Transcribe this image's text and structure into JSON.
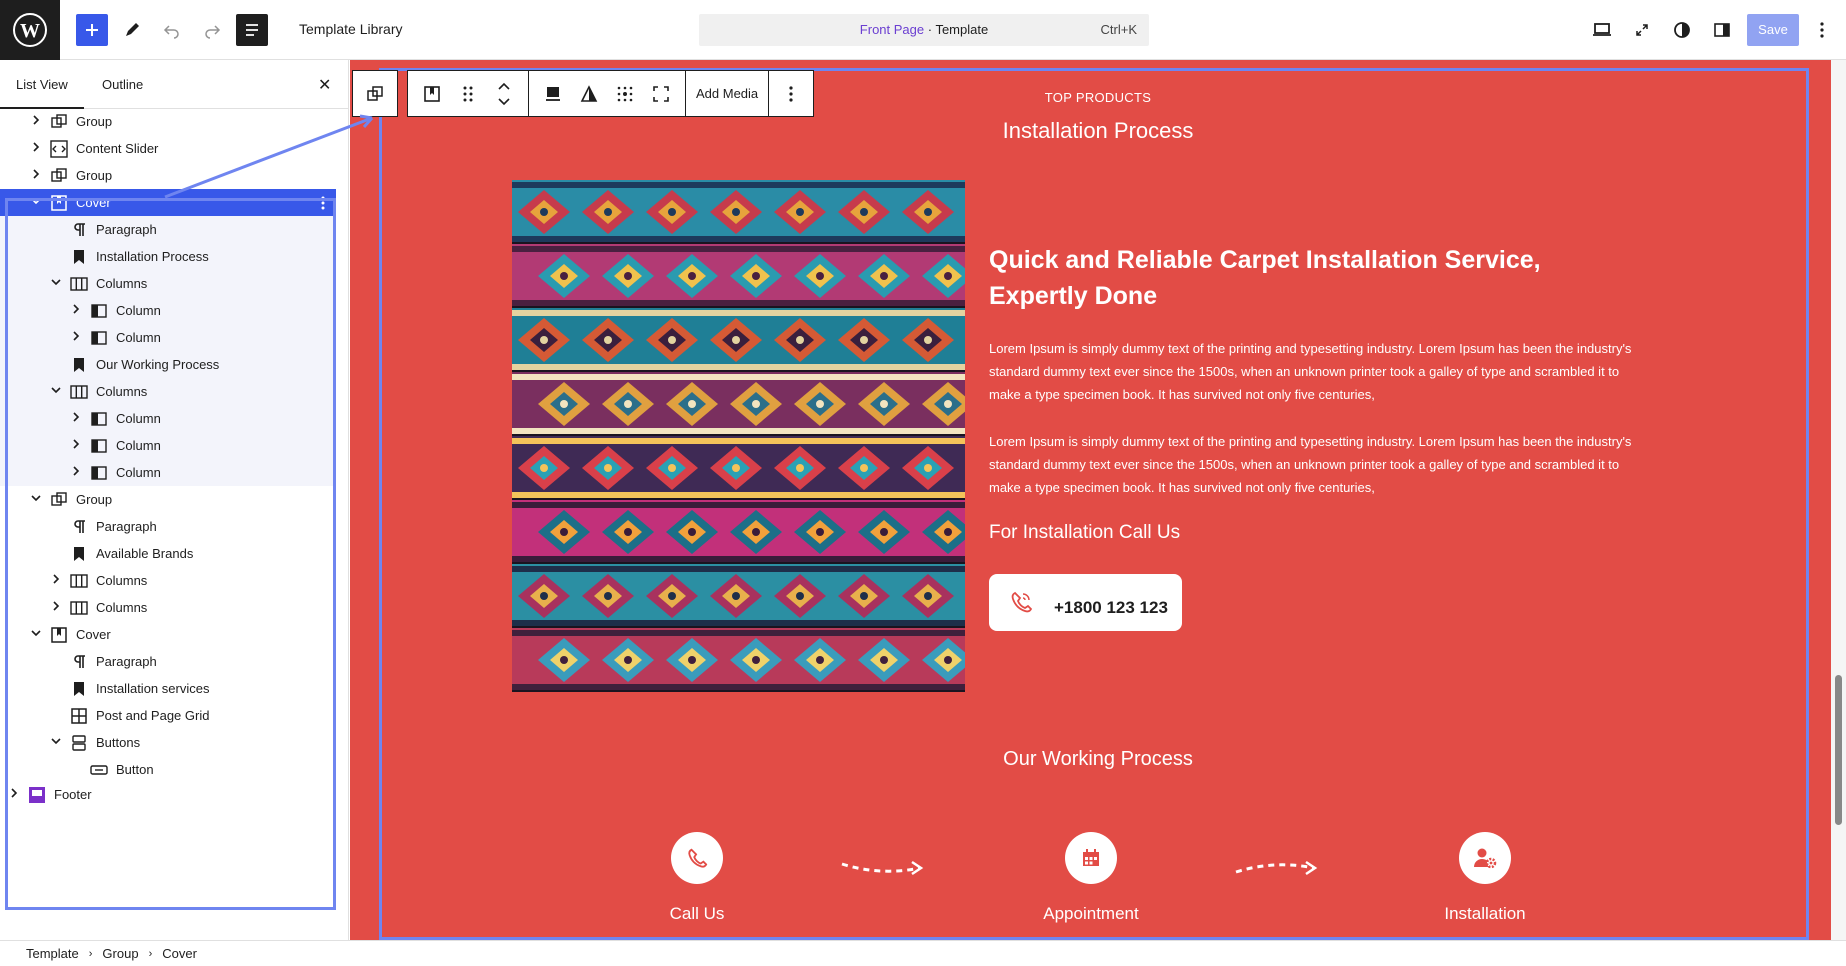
{
  "header": {
    "doc_title": "Template Library",
    "command_bar": {
      "page": "Front Page",
      "separator": " · ",
      "type": "Template",
      "shortcut": "Ctrl+K"
    },
    "save_label": "Save"
  },
  "sidebar": {
    "tabs": [
      "List View",
      "Outline"
    ],
    "active_tab": "List View",
    "tree": [
      {
        "label": "Group",
        "level": 1,
        "icon": "group-icon",
        "expand": "collapsed"
      },
      {
        "label": "Content Slider",
        "level": 1,
        "icon": "code-block-icon",
        "expand": "collapsed"
      },
      {
        "label": "Group",
        "level": 1,
        "icon": "group-icon",
        "expand": "collapsed"
      },
      {
        "label": "Cover",
        "level": 1,
        "icon": "cover-icon",
        "expand": "expanded",
        "selected": true
      },
      {
        "label": "Paragraph",
        "level": 2,
        "icon": "paragraph-icon",
        "expand": "none"
      },
      {
        "label": "Installation Process",
        "level": 2,
        "icon": "heading-bookmark-icon",
        "expand": "none"
      },
      {
        "label": "Columns",
        "level": 2,
        "icon": "columns-icon",
        "expand": "expanded"
      },
      {
        "label": "Column",
        "level": 3,
        "icon": "column-icon",
        "expand": "collapsed"
      },
      {
        "label": "Column",
        "level": 3,
        "icon": "column-icon",
        "expand": "collapsed"
      },
      {
        "label": "Our Working Process",
        "level": 2,
        "icon": "heading-bookmark-icon",
        "expand": "none"
      },
      {
        "label": "Columns",
        "level": 2,
        "icon": "columns-icon",
        "expand": "expanded"
      },
      {
        "label": "Column",
        "level": 3,
        "icon": "column-icon",
        "expand": "collapsed"
      },
      {
        "label": "Column",
        "level": 3,
        "icon": "column-icon",
        "expand": "collapsed"
      },
      {
        "label": "Column",
        "level": 3,
        "icon": "column-icon",
        "expand": "collapsed"
      },
      {
        "label": "Group",
        "level": 1,
        "icon": "group-icon",
        "expand": "expanded"
      },
      {
        "label": "Paragraph",
        "level": 2,
        "icon": "paragraph-icon",
        "expand": "none"
      },
      {
        "label": "Available Brands",
        "level": 2,
        "icon": "heading-bookmark-icon",
        "expand": "none"
      },
      {
        "label": "Columns",
        "level": 2,
        "icon": "columns-icon",
        "expand": "collapsed"
      },
      {
        "label": "Columns",
        "level": 2,
        "icon": "columns-icon",
        "expand": "collapsed"
      },
      {
        "label": "Cover",
        "level": 1,
        "icon": "cover-icon",
        "expand": "expanded"
      },
      {
        "label": "Paragraph",
        "level": 2,
        "icon": "paragraph-icon",
        "expand": "none"
      },
      {
        "label": "Installation services",
        "level": 2,
        "icon": "heading-bookmark-icon",
        "expand": "none"
      },
      {
        "label": "Post and Page Grid",
        "level": 2,
        "icon": "grid-icon",
        "expand": "none"
      },
      {
        "label": "Buttons",
        "level": 2,
        "icon": "buttons-icon",
        "expand": "expanded"
      },
      {
        "label": "Button",
        "level": 3,
        "icon": "button-icon",
        "expand": "none"
      },
      {
        "label": "Footer",
        "level": 0,
        "icon": "template-part-icon",
        "expand": "collapsed"
      }
    ]
  },
  "breadcrumb": [
    "Template",
    "Group",
    "Cover"
  ],
  "toolbar": {
    "add_media_label": "Add Media"
  },
  "canvas": {
    "eyebrow": "TOP PRODUCTS",
    "section_title": "Installation Process",
    "headline": "Quick and Reliable Carpet Installation Service, Expertly Done",
    "paragraph_1": "Lorem Ipsum is simply dummy text of the printing and typesetting industry. Lorem Ipsum has been the industry's standard dummy text ever since the 1500s, when an unknown printer took a galley of type and scrambled it to make a type specimen book. It has survived not only five centuries,",
    "paragraph_2": "Lorem Ipsum is simply dummy text of the printing and typesetting industry. Lorem Ipsum has been the industry's standard dummy text ever since the 1500s, when an unknown printer took a galley of type and scrambled it to make a type specimen book. It has survived not only five centuries,",
    "call_title": "For Installation Call Us",
    "phone": "+1800 123 123",
    "working_title": "Our Working Process",
    "steps": [
      "Call Us",
      "Appointment",
      "Installation"
    ]
  },
  "colors": {
    "cover_bg": "#e24c46",
    "accent": "#3858e9",
    "selection_outline": "#6f85f0",
    "command_purple": "#6b3fd1"
  }
}
